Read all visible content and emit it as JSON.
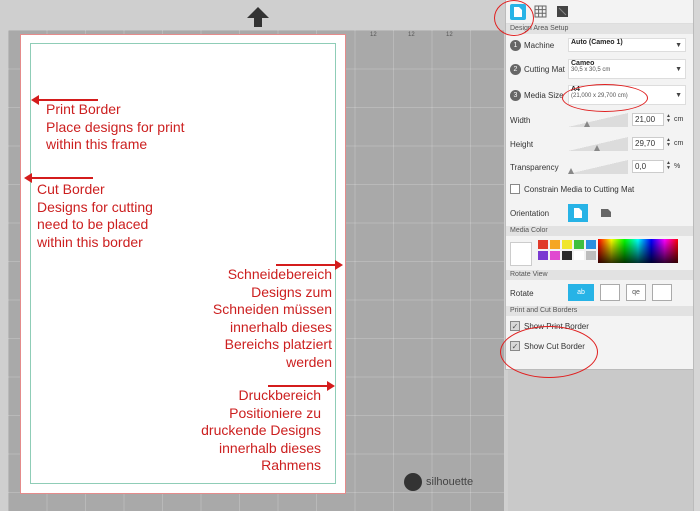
{
  "colors": {
    "accent": "#27b3e6",
    "annotation": "#cc1f1f",
    "page_border": "#e58b8b",
    "print_border": "#8fcdb7"
  },
  "mat": {
    "ticks": [
      "12",
      "12",
      "12"
    ],
    "brand": "silhouette",
    "upload_icon": "up-arrow-icon"
  },
  "annotations": {
    "print_border": [
      "Print Border",
      "Place designs for print",
      "within this frame"
    ],
    "cut_border": [
      "Cut Border",
      "Designs for cutting",
      "need to be placed",
      "within this border"
    ],
    "schneidebereich": [
      "Schneidebereich",
      "Designs zum",
      "Schneiden müssen",
      "innerhalb dieses",
      "Bereichs platziert",
      "werden"
    ],
    "druckbereich": [
      "Druckbereich",
      "Positioniere zu",
      "druckende Designs",
      "innerhalb dieses",
      "Rahmens"
    ]
  },
  "panel": {
    "tabs": [
      {
        "name": "page-setup-tab",
        "icon": "page-icon",
        "active": true
      },
      {
        "name": "grid-tab",
        "icon": "grid-icon",
        "active": false
      },
      {
        "name": "background-tab",
        "icon": "image-icon",
        "active": false
      }
    ],
    "design_area_setup": {
      "heading": "Design Area Setup",
      "machine": {
        "num": "1",
        "label": "Machine",
        "value": "Auto (Cameo 1)"
      },
      "cutting_mat": {
        "num": "2",
        "label": "Cutting Mat",
        "value": "Cameo",
        "sub": "30,5 x 30,5 cm"
      },
      "media_size": {
        "num": "3",
        "label": "Media Size",
        "value": "A4",
        "sub": "(21,000 x 29,700 cm)"
      },
      "width": {
        "label": "Width",
        "value": "21,00",
        "unit": "cm"
      },
      "height": {
        "label": "Height",
        "value": "29,70",
        "unit": "cm"
      },
      "transparency": {
        "label": "Transparency",
        "value": "0,0",
        "unit": "%"
      },
      "constrain": {
        "label": "Constrain Media to Cutting Mat",
        "checked": false
      },
      "orientation": {
        "label": "Orientation"
      }
    },
    "media_color": {
      "heading": "Media Color",
      "swatches": [
        "#e03a2a",
        "#f5a623",
        "#f0e62b",
        "#3fbf3f",
        "#2b8fe0",
        "#7a3ad1",
        "#e04ad0",
        "#2a2a2a",
        "#ffffff",
        "#bdbdbd"
      ]
    },
    "rotate_view": {
      "heading": "Rotate View",
      "label": "Rotate",
      "buttons": [
        "ab",
        "",
        "qe",
        ""
      ]
    },
    "print_cut_borders": {
      "heading": "Print and Cut Borders",
      "show_print": {
        "label": "Show Print Border",
        "checked": true
      },
      "show_cut": {
        "label": "Show Cut Border",
        "checked": true
      }
    }
  }
}
